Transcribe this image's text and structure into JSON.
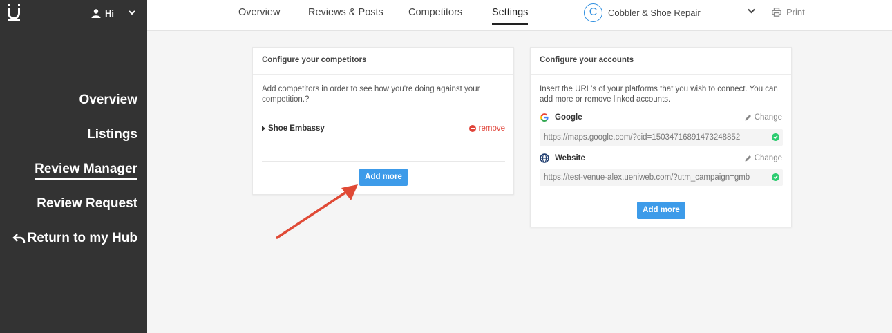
{
  "sidebar": {
    "user_label": "Hi",
    "nav": [
      {
        "label": "Overview",
        "active": false
      },
      {
        "label": "Listings",
        "active": false
      },
      {
        "label": "Review Manager",
        "active": true
      },
      {
        "label": "Review Request",
        "active": false
      },
      {
        "label": "Return to my Hub",
        "active": false
      }
    ]
  },
  "topbar": {
    "tabs": [
      {
        "label": "Overview"
      },
      {
        "label": "Reviews & Posts"
      },
      {
        "label": "Competitors"
      },
      {
        "label": "Settings",
        "active": true
      }
    ],
    "business_initial": "C",
    "business_name": "Cobbler & Shoe Repair",
    "print_label": "Print"
  },
  "competitors_card": {
    "title": "Configure your competitors",
    "description": "Add competitors in order to see how you're doing against your competition.?",
    "items": [
      {
        "name": "Shoe Embassy",
        "remove_label": "remove"
      }
    ],
    "add_more_label": "Add more"
  },
  "accounts_card": {
    "title": "Configure your accounts",
    "description": "Insert the URL's of your platforms that you wish to connect. You can add more or remove linked accounts.",
    "accounts": [
      {
        "name": "Google",
        "change_label": "Change",
        "url": "https://maps.google.com/?cid=15034716891473248852",
        "icon": "google-icon"
      },
      {
        "name": "Website",
        "change_label": "Change",
        "url": "https://test-venue-alex.ueniweb.com/?utm_campaign=gmb",
        "icon": "globe-icon"
      }
    ],
    "add_more_label": "Add more"
  },
  "colors": {
    "sidebar_bg": "#333333",
    "accent_blue": "#3d9be9",
    "remove_red": "#e0443a",
    "check_green": "#2ecc71",
    "arrow_red": "#e04a36"
  }
}
